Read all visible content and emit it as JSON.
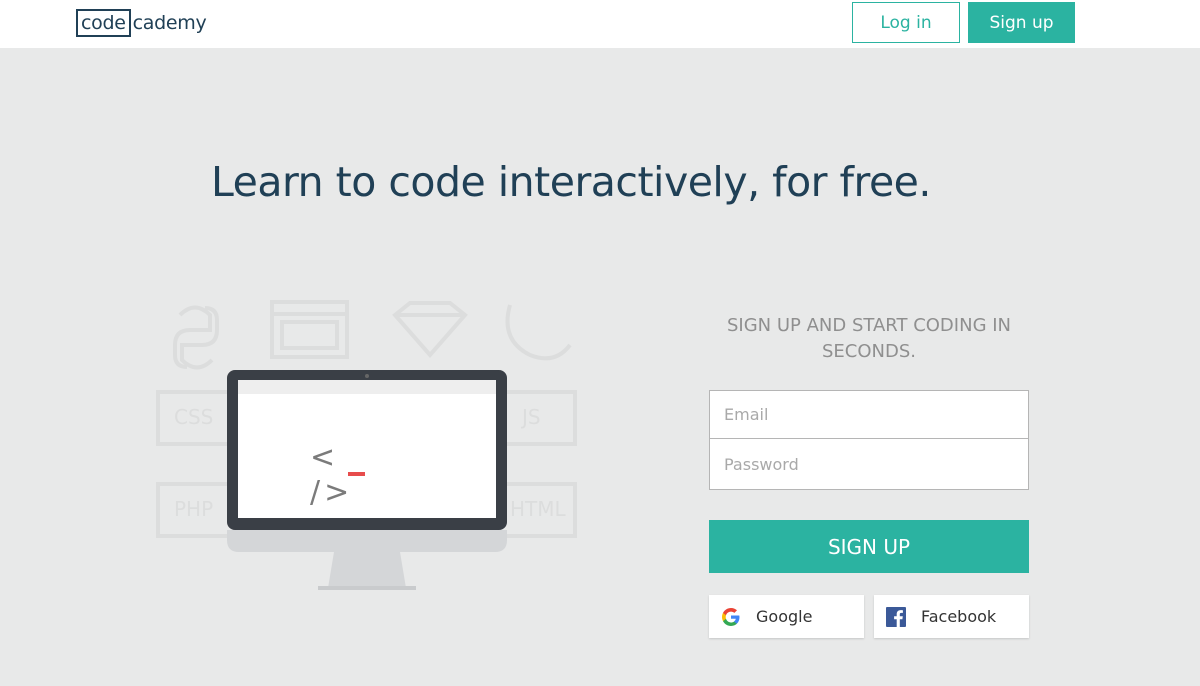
{
  "header": {
    "logo_part1": "code",
    "logo_part2": "cademy",
    "login_label": "Log in",
    "signup_label": "Sign up"
  },
  "hero": {
    "headline": "Learn to code interactively, for free."
  },
  "illustration": {
    "code_open": "<",
    "code_cursor": "_",
    "code_close": "/>",
    "faded_labels": [
      "CSS",
      "JS",
      "PHP",
      "HTML"
    ]
  },
  "signup_form": {
    "title": "SIGN UP AND START CODING IN SECONDS.",
    "email_placeholder": "Email",
    "password_placeholder": "Password",
    "submit_label": "SIGN UP",
    "google_label": "Google",
    "facebook_label": "Facebook"
  },
  "colors": {
    "accent": "#2bb3a1",
    "navy": "#204056",
    "background": "#e8e9e9",
    "cursor_red": "#e74c4c",
    "facebook_blue": "#3b5998"
  }
}
